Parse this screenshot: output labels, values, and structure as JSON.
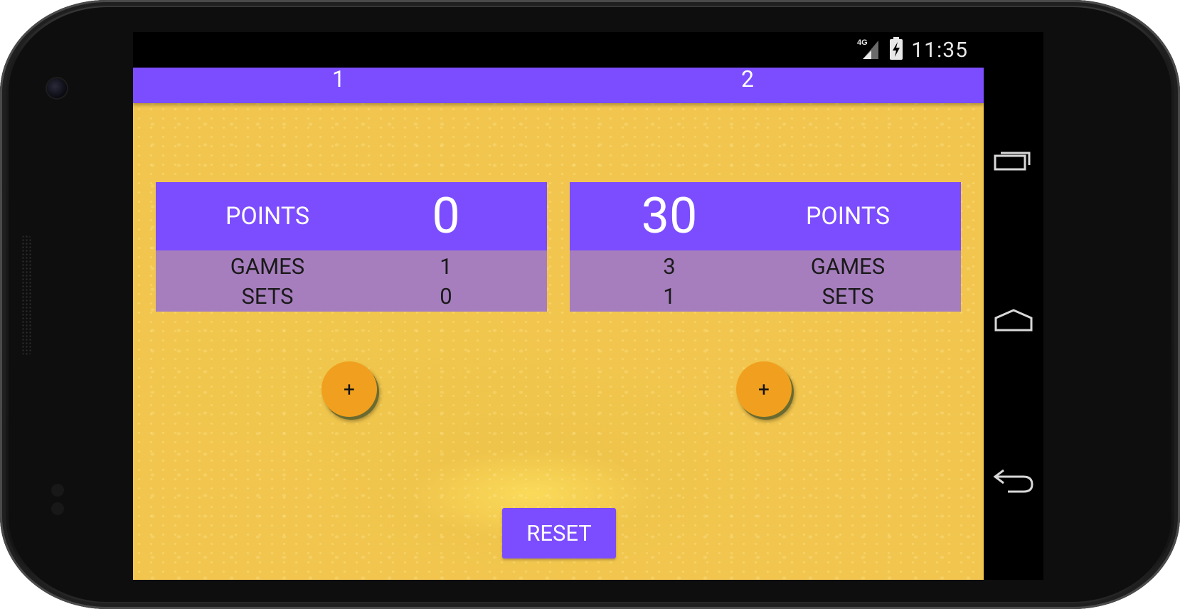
{
  "status_bar": {
    "network": "4G",
    "time": "11:35"
  },
  "teams": {
    "team1": "1",
    "team2": "2"
  },
  "team1_card": {
    "points_label": "POINTS",
    "points_value": "0",
    "games_label": "GAMES",
    "games_value": "1",
    "sets_label": "SETS",
    "sets_value": "0"
  },
  "team2_card": {
    "points_label": "POINTS",
    "points_value": "30",
    "games_label": "GAMES",
    "games_value": "3",
    "sets_label": "SETS",
    "sets_value": "1"
  },
  "buttons": {
    "add_team1": "+",
    "add_team2": "+",
    "reset": "RESET"
  },
  "nav": {
    "recent_icon": "recent-apps-icon",
    "home_icon": "home-icon",
    "back_icon": "back-icon"
  },
  "colors": {
    "primary": "#7c4dff",
    "stats_row": "#a67ebd",
    "accent": "#f0a01e",
    "background": "#f2c64e"
  }
}
